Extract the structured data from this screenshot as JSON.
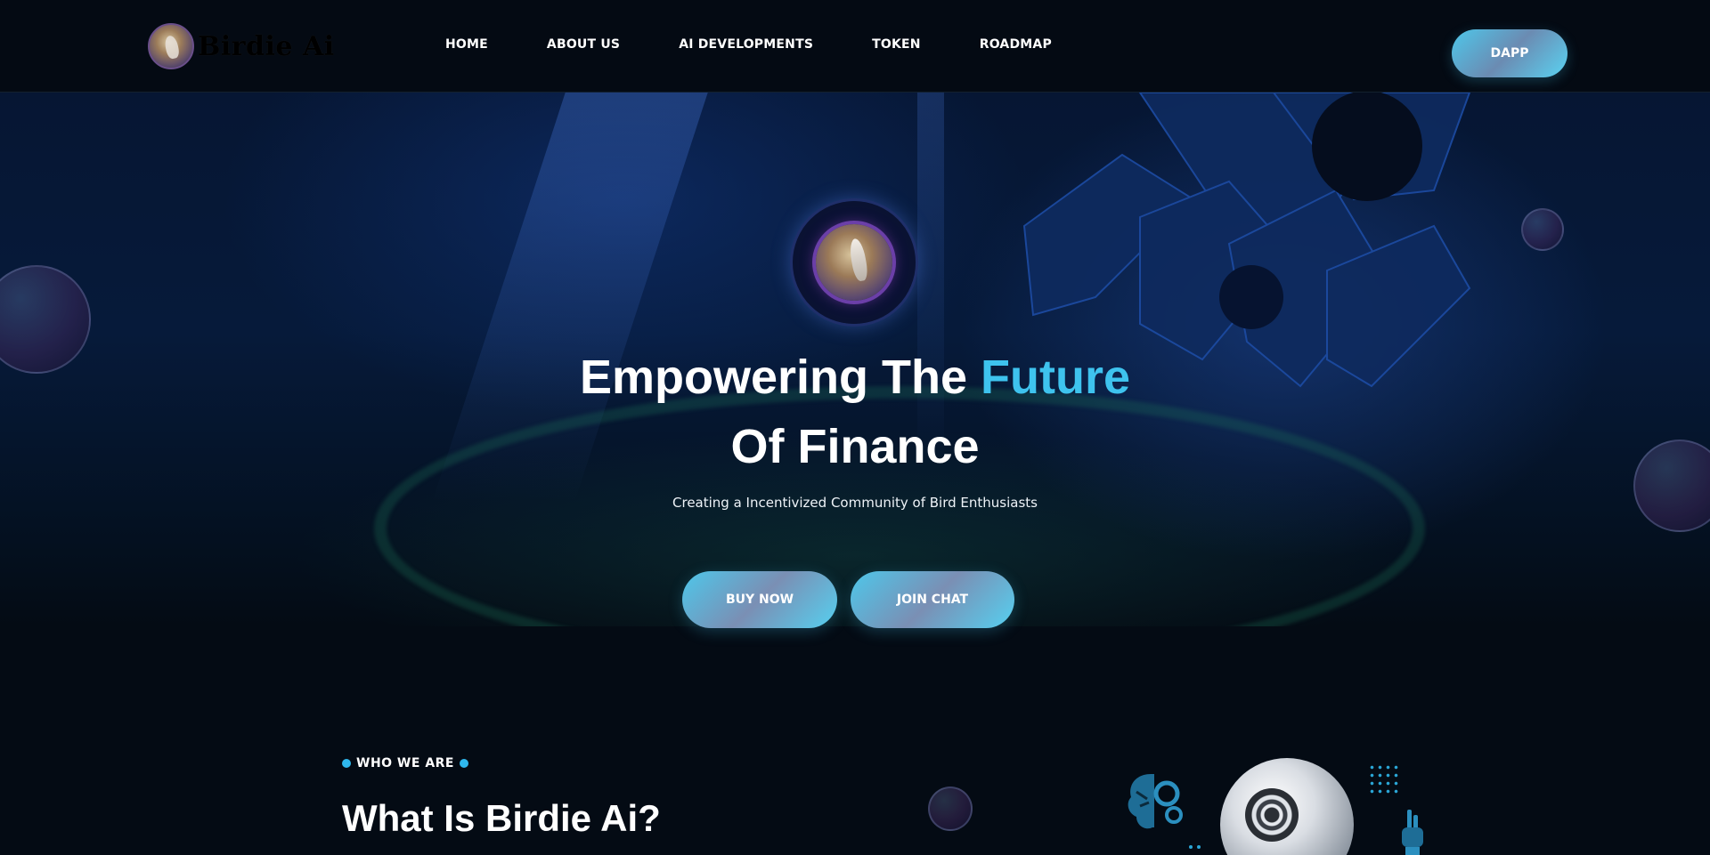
{
  "header": {
    "logo_text": "Birdie Ai",
    "nav": [
      {
        "label": "HOME"
      },
      {
        "label": "ABOUT US"
      },
      {
        "label": "AI DEVELOPMENTS"
      },
      {
        "label": "TOKEN"
      },
      {
        "label": "ROADMAP"
      }
    ],
    "dapp_label": "DAPP"
  },
  "hero": {
    "title_part1": "Empowering The",
    "title_accent": "Future",
    "title_line2": "Of Finance",
    "subtitle": "Creating a Incentivized Community of Bird Enthusiasts",
    "buy_label": "BUY NOW",
    "chat_label": "JOIN CHAT"
  },
  "about": {
    "eyebrow": "WHO WE ARE",
    "title": "What Is Birdie Ai?"
  },
  "colors": {
    "accent": "#3ec3ee",
    "background": "#040b14",
    "button_gradient_start": "#4ec7ea",
    "button_gradient_mid": "#7a8fb4"
  },
  "icons": [
    "bird-logo-icon",
    "brain-gear-icon",
    "robot-hand-icon",
    "dot-grid-icon"
  ]
}
